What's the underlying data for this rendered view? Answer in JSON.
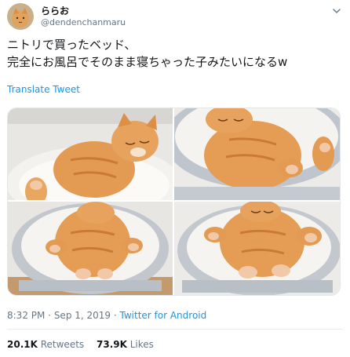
{
  "user": {
    "name": "ららお",
    "handle": "@dendenchanmaru",
    "avatar_icon": "cat-avatar-icon"
  },
  "tweet": {
    "text_lines": [
      "ニトリで買ったベッド、",
      "完全にお風呂でそのまま寝ちゃった子みたいになるw"
    ],
    "translate_label": "Translate Tweet",
    "photos": [
      {
        "icon": "cat-in-bed-photo-1"
      },
      {
        "icon": "cat-in-bed-photo-2"
      },
      {
        "icon": "cat-in-bed-photo-3"
      },
      {
        "icon": "cat-in-bed-photo-4"
      }
    ]
  },
  "meta": {
    "time": "8:32 PM",
    "sep": " · ",
    "date": "Sep 1, 2019",
    "source": "Twitter for Android"
  },
  "stats": {
    "retweets_count": "20.1K",
    "retweets_label": "Retweets",
    "likes_count": "73.9K",
    "likes_label": "Likes"
  },
  "colors": {
    "link": "#1b95e0",
    "muted": "#657786",
    "text": "#14171a"
  }
}
